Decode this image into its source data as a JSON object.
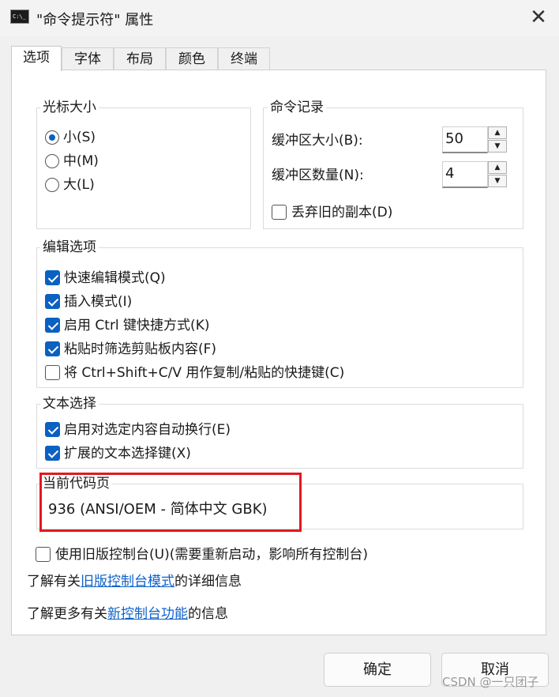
{
  "window": {
    "title": "\"命令提示符\" 属性",
    "icon_text": "C:\\_",
    "close_glyph": "✕"
  },
  "tabs": [
    "选项",
    "字体",
    "布局",
    "颜色",
    "终端"
  ],
  "cursor_size": {
    "title": "光标大小",
    "options": [
      {
        "label": "小(S)",
        "selected": true
      },
      {
        "label": "中(M)",
        "selected": false
      },
      {
        "label": "大(L)",
        "selected": false
      }
    ]
  },
  "command_history": {
    "title": "命令记录",
    "buffer_size_label": "缓冲区大小(B):",
    "buffer_size_value": "50",
    "buffer_count_label": "缓冲区数量(N):",
    "buffer_count_value": "4",
    "discard_label": "丢弃旧的副本(D)",
    "discard_checked": false
  },
  "edit_options": {
    "title": "编辑选项",
    "items": [
      {
        "label": "快速编辑模式(Q)",
        "checked": true
      },
      {
        "label": "插入模式(I)",
        "checked": true
      },
      {
        "label": "启用 Ctrl 键快捷方式(K)",
        "checked": true
      },
      {
        "label": "粘贴时筛选剪贴板内容(F)",
        "checked": true
      },
      {
        "label": "将 Ctrl+Shift+C/V 用作复制/粘贴的快捷键(C)",
        "checked": false
      }
    ]
  },
  "text_selection": {
    "title": "文本选择",
    "items": [
      {
        "label": "启用对选定内容自动换行(E)",
        "checked": true
      },
      {
        "label": "扩展的文本选择键(X)",
        "checked": true
      }
    ]
  },
  "code_page": {
    "title": "当前代码页",
    "value": "936   (ANSI/OEM - 简体中文 GBK)"
  },
  "legacy": {
    "label": "使用旧版控制台(U)(需要重新启动，影响所有控制台)",
    "checked": false,
    "info1_prefix": "了解有关",
    "info1_link": "旧版控制台模式",
    "info1_suffix": "的详细信息",
    "info2_prefix": "了解更多有关",
    "info2_link": "新控制台功能",
    "info2_suffix": "的信息"
  },
  "buttons": {
    "ok": "确定",
    "cancel": "取消"
  },
  "watermark": "CSDN @一只团子",
  "colors": {
    "accent": "#0a61c2",
    "highlight_border": "#e0191d",
    "link": "#0f62c9"
  }
}
